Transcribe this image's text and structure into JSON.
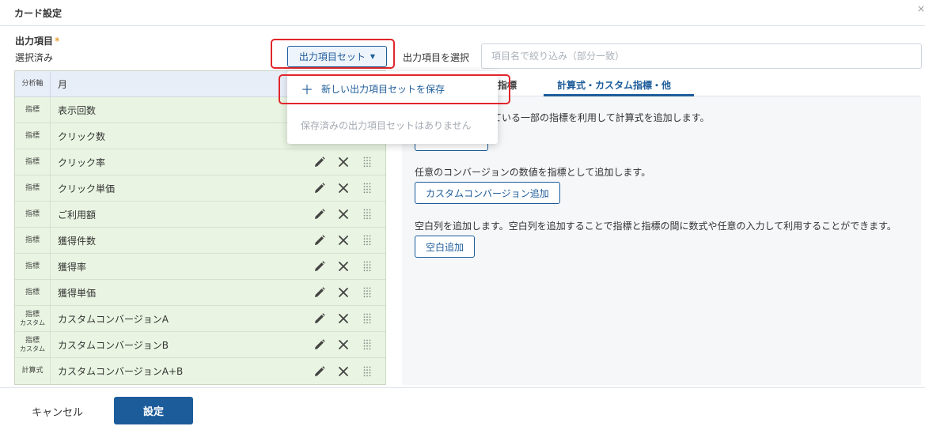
{
  "header": {
    "title": "カード設定",
    "close": "×"
  },
  "output": {
    "label": "出力項目",
    "required_mark": "*",
    "selected_label": "選択済み",
    "set_button": "出力項目セット",
    "select_label": "出力項目を選択",
    "filter_placeholder": "項目名で絞り込み（部分一致）"
  },
  "table": {
    "header": {
      "type": "分析軸",
      "name": "月"
    },
    "rows": [
      {
        "type": "指標",
        "type2": "",
        "name": "表示回数"
      },
      {
        "type": "指標",
        "type2": "",
        "name": "クリック数"
      },
      {
        "type": "指標",
        "type2": "",
        "name": "クリック率"
      },
      {
        "type": "指標",
        "type2": "",
        "name": "クリック単価"
      },
      {
        "type": "指標",
        "type2": "",
        "name": "ご利用額"
      },
      {
        "type": "指標",
        "type2": "",
        "name": "獲得件数"
      },
      {
        "type": "指標",
        "type2": "",
        "name": "獲得率"
      },
      {
        "type": "指標",
        "type2": "",
        "name": "獲得単価"
      },
      {
        "type": "指標",
        "type2": "カスタム",
        "name": "カスタムコンバージョンA"
      },
      {
        "type": "指標",
        "type2": "カスタム",
        "name": "カスタムコンバージョンB"
      },
      {
        "type": "計算式",
        "type2": "",
        "name": "カスタムコンバージョンA+B"
      }
    ]
  },
  "tabs": [
    {
      "label": "指標"
    },
    {
      "label": "計算式・カスタム指標・他"
    }
  ],
  "panel": {
    "formula_desc": "ている一部の指標を利用して計算式を追加します。",
    "cv_desc": "任意のコンバージョンの数値を指標として追加します。",
    "cv_button": "カスタムコンバージョン追加",
    "blank_desc": "空白列を追加します。空白列を追加することで指標と指標の間に数式や任意の入力して利用することができます。",
    "blank_button": "空白追加"
  },
  "dropdown": {
    "new_item": "新しい出力項目セットを保存",
    "empty_item": "保存済みの出力項目セットはありません"
  },
  "footer": {
    "cancel": "キャンセル",
    "submit": "設定"
  },
  "colors": {
    "accent": "#1d5c9a",
    "highlight": "#e0262b",
    "row_bg": "#e9f5e2"
  }
}
